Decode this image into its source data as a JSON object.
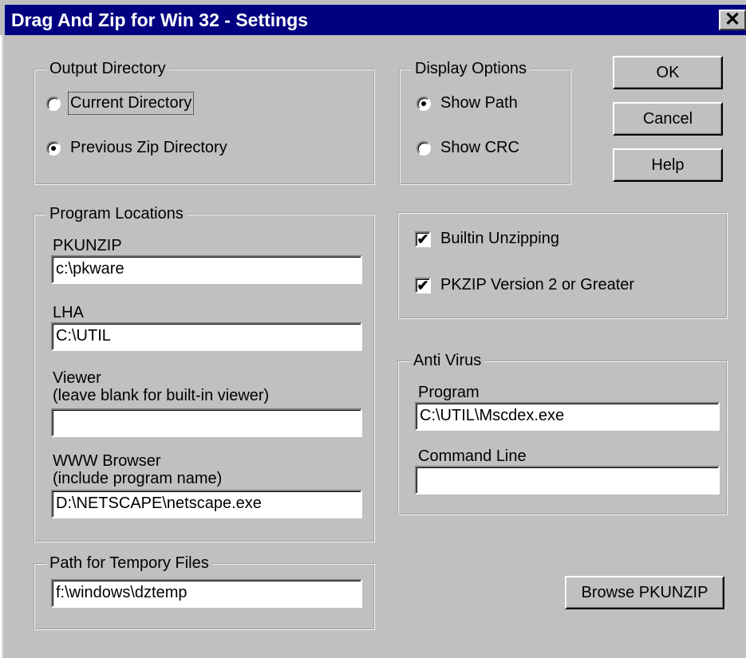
{
  "window": {
    "title": "Drag And Zip for Win 32 - Settings",
    "close_label": "✕"
  },
  "output_directory": {
    "legend": "Output Directory",
    "options": [
      {
        "label": "Current Directory",
        "selected": false
      },
      {
        "label": "Previous Zip Directory",
        "selected": true
      }
    ]
  },
  "display_options": {
    "legend": "Display Options",
    "options": [
      {
        "label": "Show Path",
        "selected": true
      },
      {
        "label": "Show CRC",
        "selected": false
      }
    ]
  },
  "buttons": {
    "ok": "OK",
    "cancel": "Cancel",
    "help": "Help",
    "browse": "Browse PKUNZIP"
  },
  "program_locations": {
    "legend": "Program Locations",
    "pkunzip_label": "PKUNZIP",
    "pkunzip_value": "c:\\pkware",
    "lha_label": "LHA",
    "lha_value": "C:\\UTIL",
    "viewer_label": "Viewer",
    "viewer_hint": "(leave blank for built-in viewer)",
    "viewer_value": "",
    "browser_label": "WWW Browser",
    "browser_hint": "(include program name)",
    "browser_value": "D:\\NETSCAPE\\netscape.exe"
  },
  "options": {
    "builtin_unzipping": {
      "label": "Builtin Unzipping",
      "checked": true
    },
    "pkzip_v2": {
      "label": "PKZIP Version 2 or Greater",
      "checked": true
    }
  },
  "anti_virus": {
    "legend": "Anti Virus",
    "program_label": "Program",
    "program_value": "C:\\UTIL\\Mscdex.exe",
    "command_label": "Command Line",
    "command_value": ""
  },
  "temp_files": {
    "legend": "Path for Tempory Files",
    "value": "f:\\windows\\dztemp"
  },
  "icons": {
    "check_mark": "✔"
  }
}
